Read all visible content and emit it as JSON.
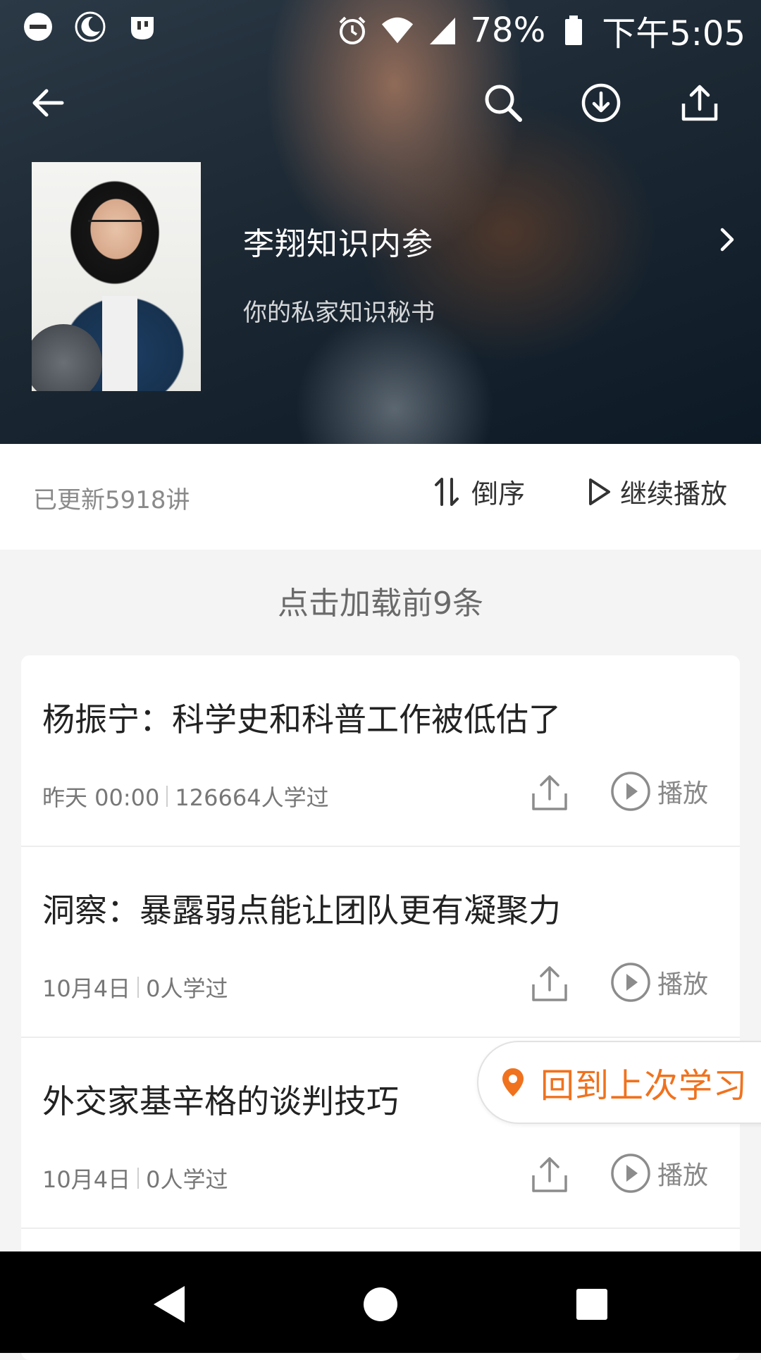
{
  "status_bar": {
    "battery_percent": "78%",
    "time": "下午5:05",
    "icons": [
      "do-not-disturb-icon",
      "night-mode-icon",
      "app-notification-icon",
      "alarm-icon",
      "wifi-icon",
      "signal-icon",
      "battery-icon"
    ]
  },
  "header": {
    "title": "李翔知识内参",
    "subtitle": "你的私家知识秘书",
    "icons": [
      "back-arrow-icon",
      "search-icon",
      "download-icon",
      "share-icon",
      "chevron-right-icon"
    ]
  },
  "toolbar": {
    "count_label": "已更新5918讲",
    "sort_label": "倒序",
    "continue_label": "继续播放"
  },
  "list": {
    "load_more_label": "点击加载前9条",
    "items": [
      {
        "title": "杨振宁：科学史和科普工作被低估了",
        "date": "昨天 00:00",
        "learners": "126664人学过",
        "play_label": "播放"
      },
      {
        "title": "洞察：暴露弱点能让团队更有凝聚力",
        "date": "10月4日",
        "learners": "0人学过",
        "play_label": "播放"
      },
      {
        "title": "外交家基辛格的谈判技巧",
        "date": "10月4日",
        "learners": "0人学过",
        "play_label": "播放"
      }
    ]
  },
  "resume_button": {
    "label": "回到上次学习",
    "color": "#f0721e"
  },
  "nav_bar": {
    "icons": [
      "back-triangle-icon",
      "home-circle-icon",
      "recents-square-icon"
    ]
  }
}
